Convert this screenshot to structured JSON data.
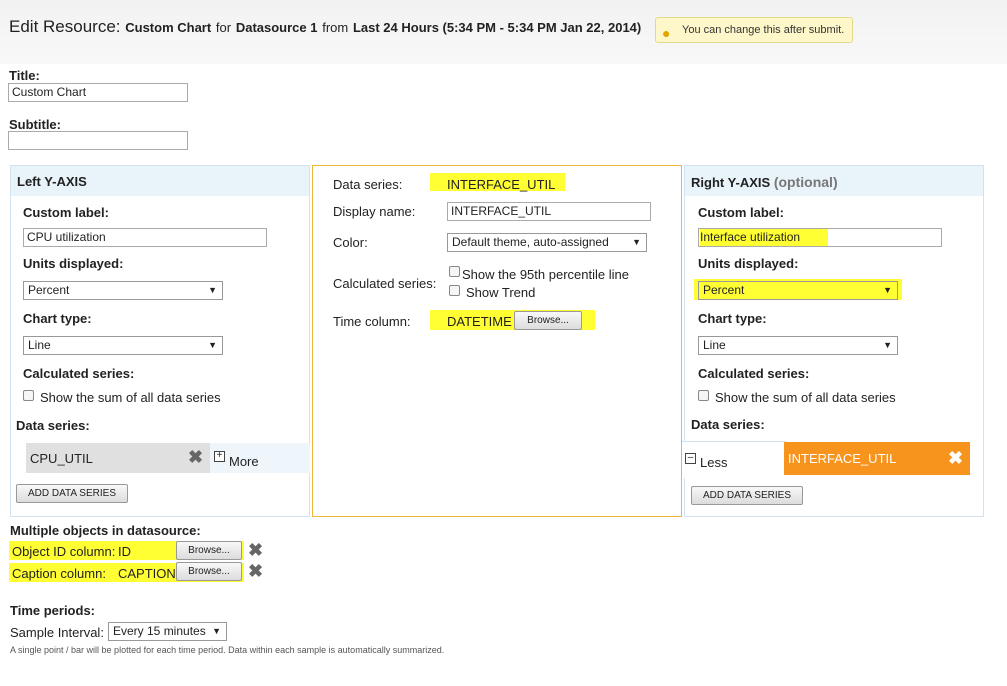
{
  "header": {
    "prefix": "Edit Resource:",
    "resource_name": "Custom Chart",
    "for_text": "for",
    "datasource": "Datasource 1",
    "from_text": "from",
    "range": "Last 24 Hours (5:34 PM - 5:34 PM Jan 22, 2014)",
    "tip": "You can change this after submit."
  },
  "title_field": {
    "label": "Title:",
    "value": "Custom Chart"
  },
  "subtitle_field": {
    "label": "Subtitle:",
    "value": ""
  },
  "left_axis": {
    "heading": "Left Y-AXIS",
    "custom_label_label": "Custom label:",
    "custom_label_value": "CPU utilization",
    "units_label": "Units displayed:",
    "units_value": "Percent",
    "chart_type_label": "Chart type:",
    "chart_type_value": "Line",
    "calc_label": "Calculated series:",
    "sum_label": "Show the sum of all data series",
    "data_series_label": "Data series:",
    "series_item": "CPU_UTIL",
    "more_label": "More",
    "add_button": "ADD DATA SERIES"
  },
  "series_detail": {
    "data_series_label": "Data series:",
    "data_series_value": "INTERFACE_UTIL",
    "display_name_label": "Display name:",
    "display_name_value": "INTERFACE_UTIL",
    "color_label": "Color:",
    "color_value": "Default theme, auto-assigned",
    "calc_label": "Calculated series:",
    "percentile_label": "Show the 95th percentile line",
    "trend_label": "Show Trend",
    "time_column_label": "Time column:",
    "time_column_value": "DATETIME",
    "browse_label": "Browse..."
  },
  "right_axis": {
    "heading": "Right Y-AXIS",
    "optional": "(optional)",
    "custom_label_label": "Custom label:",
    "custom_label_value": "Interface utilization",
    "units_label": "Units displayed:",
    "units_value": "Percent",
    "chart_type_label": "Chart type:",
    "chart_type_value": "Line",
    "calc_label": "Calculated series:",
    "sum_label": "Show the sum of all data series",
    "data_series_label": "Data series:",
    "less_label": "Less",
    "series_item": "INTERFACE_UTIL",
    "add_button": "ADD DATA SERIES"
  },
  "multi_objects": {
    "heading": "Multiple objects in datasource:",
    "object_id_label": "Object ID column:",
    "object_id_value": "ID",
    "caption_label": "Caption column:",
    "caption_value": "CAPTION",
    "browse_label": "Browse..."
  },
  "time_periods": {
    "heading": "Time periods:",
    "sample_label": "Sample Interval:",
    "sample_value": "Every 15 minutes",
    "note": "A single point / bar will be plotted for each time period. Data within each sample is automatically summarized."
  },
  "colors": {
    "highlight": "#ffff33",
    "accent": "#f7941d",
    "panel_header": "#e9f3fa"
  }
}
